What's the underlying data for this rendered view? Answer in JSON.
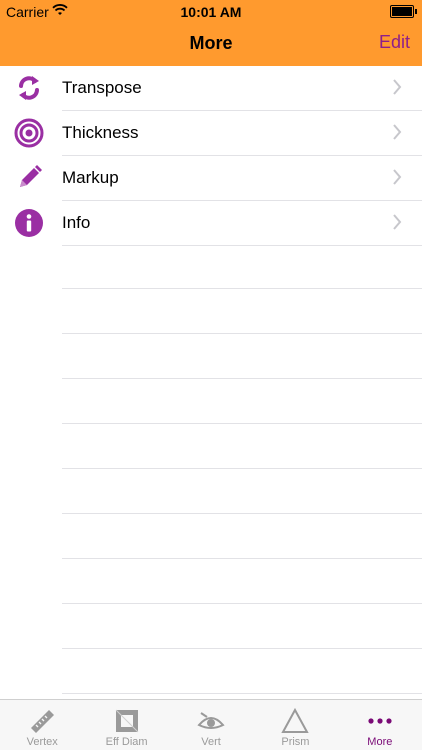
{
  "status": {
    "carrier": "Carrier",
    "time": "10:01 AM"
  },
  "nav": {
    "title": "More",
    "edit_label": "Edit"
  },
  "colors": {
    "header_bg": "#ff9a2e",
    "accent": "#8e1f8b",
    "icon": "#9a2fa3"
  },
  "rows": [
    {
      "label": "Transpose",
      "icon": "refresh-icon"
    },
    {
      "label": "Thickness",
      "icon": "target-icon"
    },
    {
      "label": "Markup",
      "icon": "pencil-icon"
    },
    {
      "label": "Info",
      "icon": "info-icon"
    }
  ],
  "tabs": [
    {
      "label": "Vertex",
      "icon": "ruler-icon",
      "active": false
    },
    {
      "label": "Eff Diam",
      "icon": "frame-icon",
      "active": false
    },
    {
      "label": "Vert",
      "icon": "eye-icon",
      "active": false
    },
    {
      "label": "Prism",
      "icon": "triangle-icon",
      "active": false
    },
    {
      "label": "More",
      "icon": "dots-icon",
      "active": true
    }
  ]
}
